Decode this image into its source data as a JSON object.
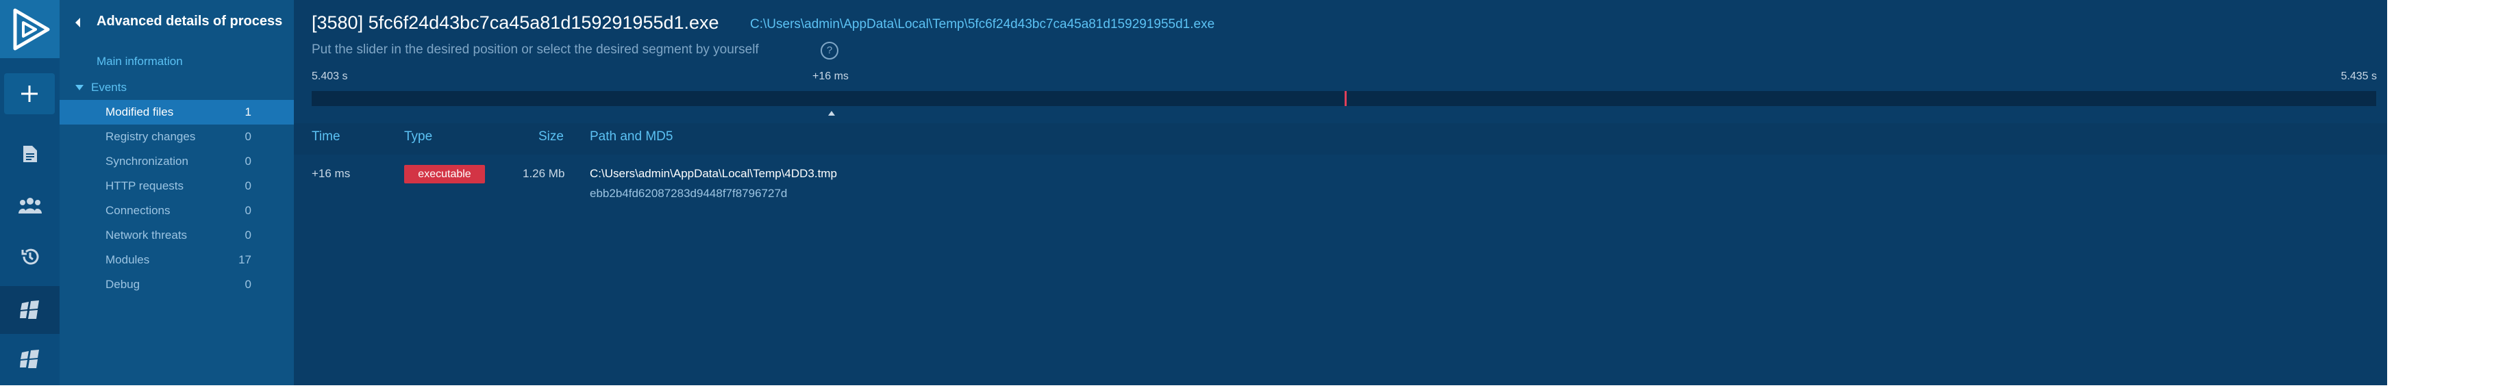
{
  "rail": {
    "icons": [
      "logo-play-icon",
      "add-icon",
      "document-icon",
      "users-icon",
      "history-icon",
      "windows-icon",
      "windows-icon"
    ]
  },
  "sidebar": {
    "title": "Advanced details of process",
    "main_information": "Main information",
    "events_label": "Events",
    "items": [
      {
        "label": "Modified files",
        "count": "1",
        "active": true
      },
      {
        "label": "Registry changes",
        "count": "0"
      },
      {
        "label": "Synchronization",
        "count": "0"
      },
      {
        "label": "HTTP requests",
        "count": "0"
      },
      {
        "label": "Connections",
        "count": "0"
      },
      {
        "label": "Network threats",
        "count": "0"
      },
      {
        "label": "Modules",
        "count": "17"
      },
      {
        "label": "Debug",
        "count": "0"
      }
    ]
  },
  "process": {
    "title": "[3580] 5fc6f24d43bc7ca45a81d159291955d1.exe",
    "path": "C:\\Users\\admin\\AppData\\Local\\Temp\\5fc6f24d43bc7ca45a81d159291955d1.exe"
  },
  "timeline": {
    "hint": "Put the slider in the desired position or select the desired segment by yourself",
    "help": "?",
    "start": "5.403 s",
    "mid": "+16 ms",
    "end": "5.435 s"
  },
  "table": {
    "headers": {
      "time": "Time",
      "type": "Type",
      "size": "Size",
      "path": "Path and MD5"
    },
    "rows": [
      {
        "time": "+16 ms",
        "type": "executable",
        "size": "1.26 Mb",
        "path": "C:\\Users\\admin\\AppData\\Local\\Temp\\4DD3.tmp",
        "md5": "ebb2b4fd62087283d9448f7f8796727d"
      }
    ]
  },
  "colors": {
    "background": "#0a3d67",
    "sidebar": "#0e5384",
    "accent": "#5cc2f4",
    "badge": "#d33445",
    "marker": "#e0405a"
  }
}
